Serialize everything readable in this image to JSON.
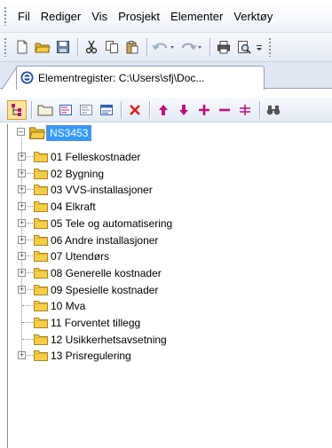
{
  "menubar": {
    "items": [
      "Fil",
      "Rediger",
      "Vis",
      "Prosjekt",
      "Elementer",
      "Verktøy"
    ]
  },
  "tab": {
    "label": "Elementregister: C:\\Users\\sfj\\Doc..."
  },
  "tree": {
    "root": "NS3453",
    "items": [
      {
        "label": "01 Felleskostnader",
        "expandable": true
      },
      {
        "label": "02 Bygning",
        "expandable": true
      },
      {
        "label": "03 VVS-installasjoner",
        "expandable": true
      },
      {
        "label": "04 Elkraft",
        "expandable": true
      },
      {
        "label": "05 Tele og automatisering",
        "expandable": true
      },
      {
        "label": "06 Andre installasjoner",
        "expandable": true
      },
      {
        "label": "07 Utendørs",
        "expandable": true
      },
      {
        "label": "08 Generelle kostnader",
        "expandable": true
      },
      {
        "label": "09 Spesielle kostnader",
        "expandable": true
      },
      {
        "label": "10 Mva",
        "expandable": false
      },
      {
        "label": "11 Forventet tillegg",
        "expandable": false
      },
      {
        "label": "12 Usikkerhetsavsetning",
        "expandable": false
      },
      {
        "label": "13 Prisregulering",
        "expandable": true
      }
    ]
  },
  "colors": {
    "selection": "#3399ff",
    "folder": "#f5cd47",
    "delete": "#e02020",
    "accent": "#c0107a"
  }
}
